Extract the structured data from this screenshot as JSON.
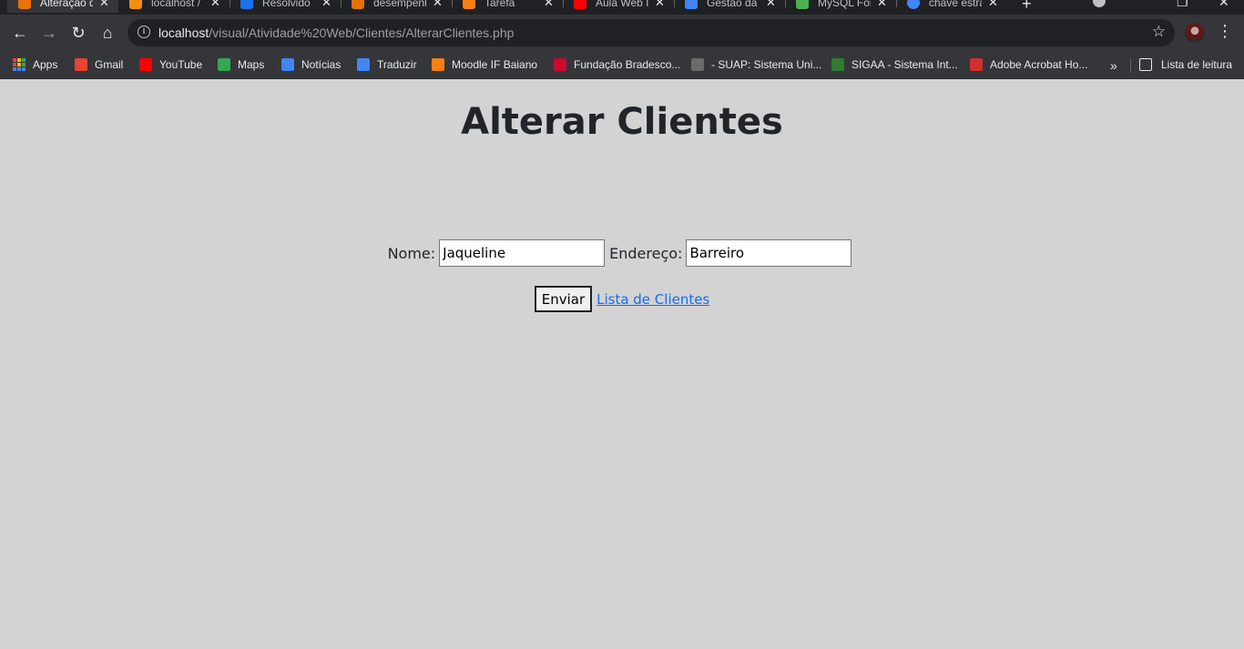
{
  "browser": {
    "tabs": [
      {
        "title": "Alteração d",
        "favicon_color": "#e8710a"
      },
      {
        "title": "localhost /",
        "favicon_color": "#f29111"
      },
      {
        "title": "Resolvido",
        "favicon_color": "#1a73e8"
      },
      {
        "title": "desempenh",
        "favicon_color": "#e37400"
      },
      {
        "title": "Tarefa",
        "favicon_color": "#f98012"
      },
      {
        "title": "Aula Web I",
        "favicon_color": "#ff0000"
      },
      {
        "title": "Gestão da",
        "favicon_color": "#4285f4"
      },
      {
        "title": "MySQL For",
        "favicon_color": "#4caf50"
      },
      {
        "title": "chave estra",
        "favicon_color": "#4285f4"
      }
    ],
    "tab_close_glyph": "✕",
    "new_tab_glyph": "+",
    "address": {
      "host": "localhost",
      "path": "/visual/Atividade%20Web/Clientes/AlterarClientes.php"
    },
    "bookmarks": [
      {
        "label": "Apps",
        "icon": "apps-icon"
      },
      {
        "label": "Gmail",
        "icon": "gmail-icon",
        "color": "#ea4335"
      },
      {
        "label": "YouTube",
        "icon": "youtube-icon",
        "color": "#ff0000"
      },
      {
        "label": "Maps",
        "icon": "maps-icon",
        "color": "#34a853"
      },
      {
        "label": "Notícias",
        "icon": "news-icon",
        "color": "#4285f4"
      },
      {
        "label": "Traduzir",
        "icon": "translate-icon",
        "color": "#4285f4"
      },
      {
        "label": "Moodle IF Baiano",
        "icon": "moodle-icon",
        "color": "#f98012"
      },
      {
        "label": "Fundação Bradesco...",
        "icon": "bradesco-icon",
        "color": "#cc092f"
      },
      {
        "label": "- SUAP: Sistema Uni...",
        "icon": "suap-icon",
        "color": "#6b6b6b"
      },
      {
        "label": "SIGAA - Sistema Int...",
        "icon": "sigaa-icon",
        "color": "#2e7d32"
      },
      {
        "label": "Adobe Acrobat Ho...",
        "icon": "acrobat-icon",
        "color": "#d32f2f"
      }
    ],
    "more_glyph": "»",
    "reading_list": "Lista de leitura"
  },
  "page": {
    "title": "Alterar Clientes",
    "form": {
      "name_label": "Nome:",
      "name_value": "Jaqueline",
      "address_label": "Endereço:",
      "address_value": "Barreiro",
      "submit_label": "Enviar",
      "list_link": "Lista de Clientes"
    }
  }
}
